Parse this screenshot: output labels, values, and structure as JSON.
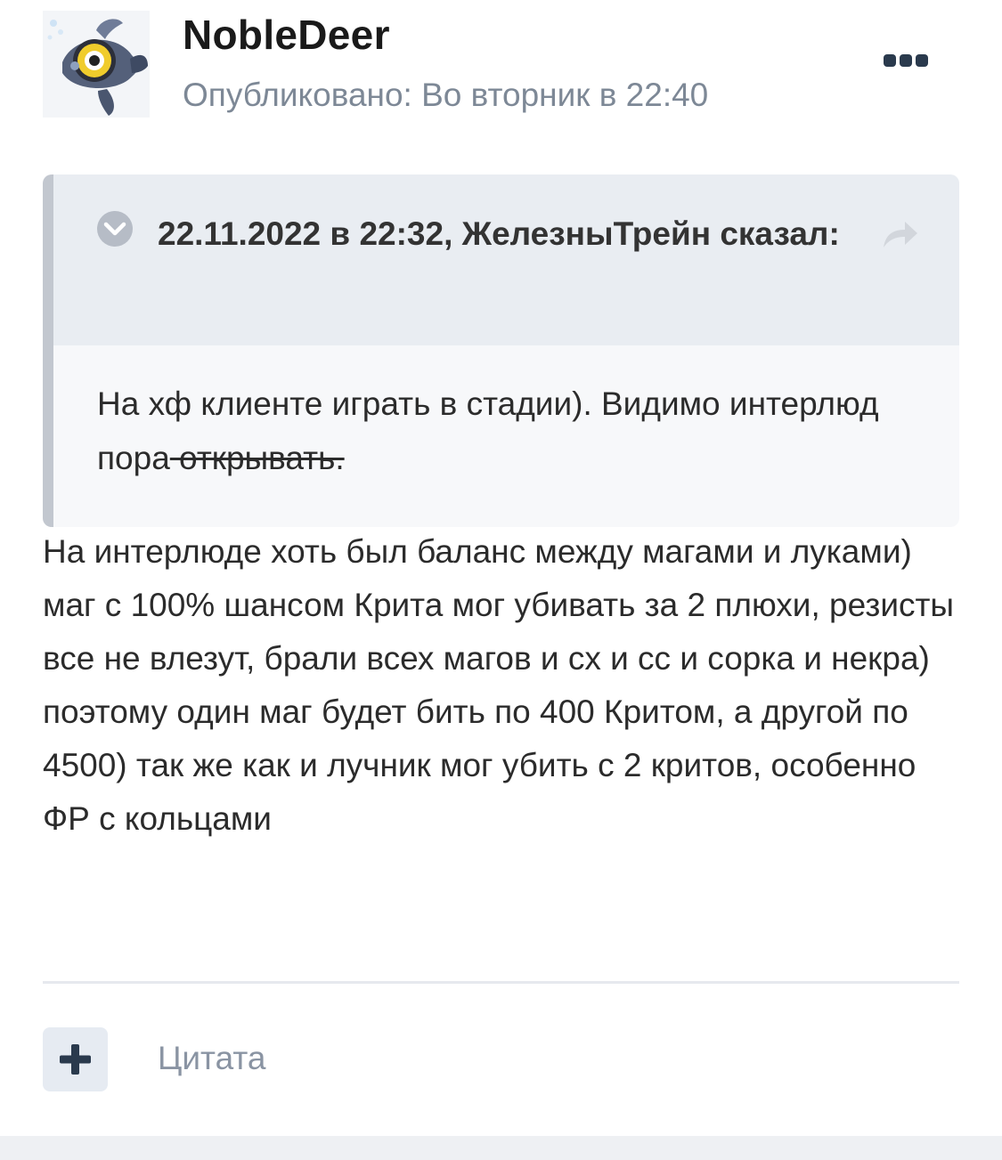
{
  "post": {
    "author": "NobleDeer",
    "published": "Опубликовано: Во вторник в 22:40",
    "avatar_icon": "fish-avatar-icon",
    "more_icon": "more-options-icon"
  },
  "quote": {
    "cite": "22.11.2022 в 22:32, ЖелезныТрейн сказал:",
    "collapse_icon": "chevron-down-circle-icon",
    "share_icon": "share-arrow-icon",
    "text_main": "На хф клиенте играть в стадии). Видимо интерлюд пора",
    "text_struck": " открывать."
  },
  "body": {
    "text": "На интерлюде хоть был баланс между магами и луками) маг с 100% шансом Крита мог убивать за 2 плюхи, резисты все не влезут, брали всех магов и сх и сс и сорка и некра) поэтому один маг будет бить по 400 Критом, а другой по 4500) так же как и лучник мог убить с 2 критов, особенно ФР с кольцами"
  },
  "footer": {
    "plus_icon": "plus-icon",
    "quote_label": "Цитата"
  },
  "colors": {
    "accent": "#2a3a4d",
    "muted": "#7d8896",
    "quote_bg": "#f7f8fa",
    "quote_head_bg": "#e9edf2",
    "quote_bar": "#c2c7cf"
  }
}
